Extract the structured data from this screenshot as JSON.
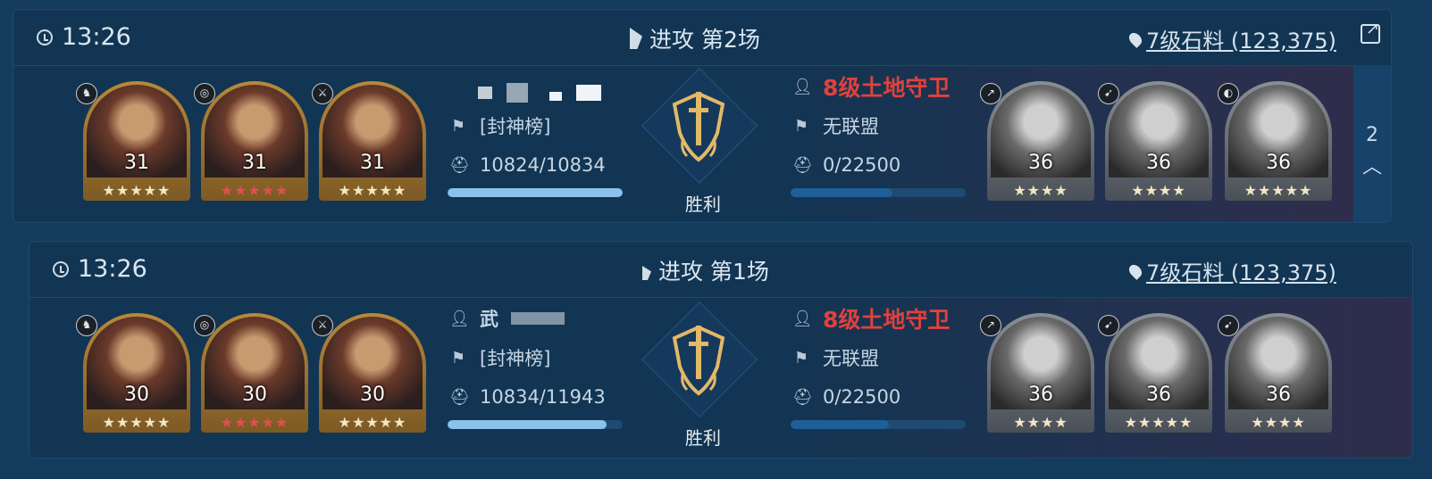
{
  "battles": [
    {
      "time": "13:26",
      "title": "进攻 第2场",
      "location": "7级石料 (123,375)",
      "player": {
        "alliance": "[封神榜]",
        "troops": "10824/10834",
        "troops_fraction": 0.999,
        "heroes": [
          {
            "level": "31",
            "stars": "★★★★★",
            "star_color": "gold"
          },
          {
            "level": "31",
            "stars": "★★★★★",
            "star_color": "red"
          },
          {
            "level": "31",
            "stars": "★★★★★",
            "star_color": "gold"
          }
        ]
      },
      "result": "胜利",
      "enemy": {
        "name": "8级土地守卫",
        "alliance": "无联盟",
        "troops": "0/22500",
        "troops_fraction": 0.58,
        "heroes": [
          {
            "level": "36",
            "stars": "★★★★"
          },
          {
            "level": "36",
            "stars": "★★★★"
          },
          {
            "level": "36",
            "stars": "★★★★★"
          }
        ]
      },
      "page_indicator": "2"
    },
    {
      "time": "13:26",
      "title": "进攻 第1场",
      "location": "7级石料 (123,375)",
      "player": {
        "name_partial": "武",
        "alliance": "[封神榜]",
        "troops": "10834/11943",
        "troops_fraction": 0.907,
        "heroes": [
          {
            "level": "30",
            "stars": "★★★★★",
            "star_color": "gold"
          },
          {
            "level": "30",
            "stars": "★★★★★",
            "star_color": "red"
          },
          {
            "level": "30",
            "stars": "★★★★★",
            "star_color": "gold"
          }
        ]
      },
      "result": "胜利",
      "enemy": {
        "name": "8级土地守卫",
        "alliance": "无联盟",
        "troops": "0/22500",
        "troops_fraction": 0.56,
        "heroes": [
          {
            "level": "36",
            "stars": "★★★★"
          },
          {
            "level": "36",
            "stars": "★★★★★"
          },
          {
            "level": "36",
            "stars": "★★★★"
          }
        ]
      }
    }
  ],
  "colors": {
    "enemy_name": "#e2413c",
    "gold_frame": "#b8893a",
    "bar_player": "#8ac2ea",
    "bar_enemy": "#1f5f98"
  }
}
